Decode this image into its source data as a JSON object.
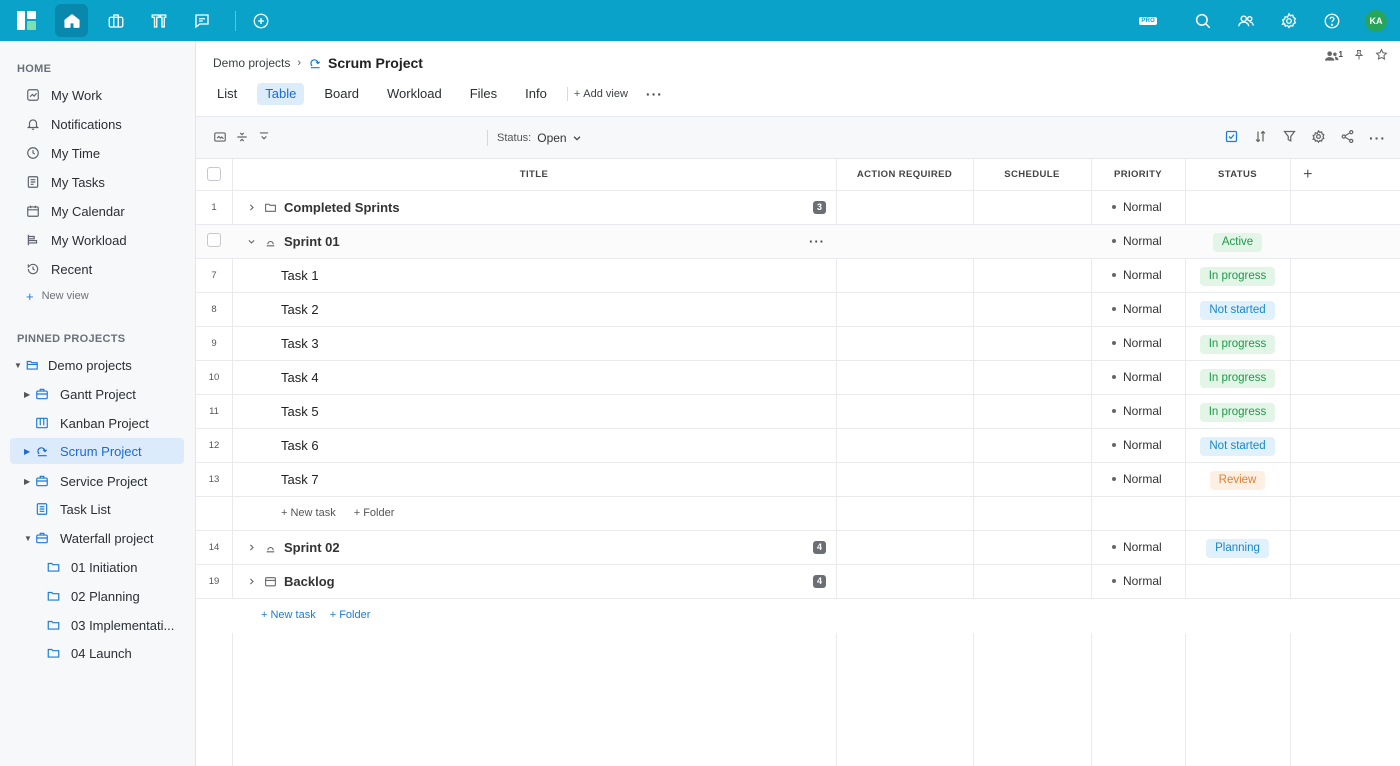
{
  "topbar": {
    "pro_badge": "PRO",
    "avatar_initials": "KA",
    "accent_color": "#0aa2c9"
  },
  "sidebar": {
    "home_section": "HOME",
    "home_items": [
      {
        "label": "My Work",
        "icon": "my-work-icon"
      },
      {
        "label": "Notifications",
        "icon": "bell-icon"
      },
      {
        "label": "My Time",
        "icon": "clock-icon"
      },
      {
        "label": "My Tasks",
        "icon": "tasks-icon"
      },
      {
        "label": "My Calendar",
        "icon": "calendar-icon"
      },
      {
        "label": "My Workload",
        "icon": "workload-icon"
      },
      {
        "label": "Recent",
        "icon": "history-icon"
      }
    ],
    "new_view": "New view",
    "pinned_section": "PINNED PROJECTS",
    "pinned_items": [
      {
        "label": "Demo projects"
      },
      {
        "label": "Gantt Project"
      },
      {
        "label": "Kanban Project"
      },
      {
        "label": "Scrum Project"
      },
      {
        "label": "Service Project"
      },
      {
        "label": "Task List"
      },
      {
        "label": "Waterfall project"
      },
      {
        "label": "01 Initiation"
      },
      {
        "label": "02 Planning"
      },
      {
        "label": "03 Implementati..."
      },
      {
        "label": "04 Launch"
      }
    ]
  },
  "header": {
    "breadcrumb_parent": "Demo projects",
    "project_title": "Scrum Project",
    "members_count": "1"
  },
  "tabs": [
    "List",
    "Table",
    "Board",
    "Workload",
    "Files",
    "Info"
  ],
  "add_view": "Add view",
  "toolbar": {
    "status_label": "Status:",
    "status_value": "Open"
  },
  "table": {
    "columns": [
      "TITLE",
      "ACTION REQUIRED",
      "SCHEDULE",
      "PRIORITY",
      "STATUS"
    ],
    "rows": [
      {
        "num": "1",
        "title": "Completed Sprints",
        "count": "3",
        "priority": "Normal",
        "status": ""
      },
      {
        "num": "",
        "title": "Sprint 01",
        "count": "",
        "priority": "Normal",
        "status": "Active"
      },
      {
        "num": "7",
        "title": "Task 1",
        "priority": "Normal",
        "status": "In progress"
      },
      {
        "num": "8",
        "title": "Task 2",
        "priority": "Normal",
        "status": "Not started"
      },
      {
        "num": "9",
        "title": "Task 3",
        "priority": "Normal",
        "status": "In progress"
      },
      {
        "num": "10",
        "title": "Task 4",
        "priority": "Normal",
        "status": "In progress"
      },
      {
        "num": "11",
        "title": "Task 5",
        "priority": "Normal",
        "status": "In progress"
      },
      {
        "num": "12",
        "title": "Task 6",
        "priority": "Normal",
        "status": "Not started"
      },
      {
        "num": "13",
        "title": "Task 7",
        "priority": "Normal",
        "status": "Review"
      },
      {
        "num": "14",
        "title": "Sprint 02",
        "count": "4",
        "priority": "Normal",
        "status": "Planning"
      },
      {
        "num": "19",
        "title": "Backlog",
        "count": "4",
        "priority": "Normal",
        "status": ""
      }
    ],
    "new_task": "+ New task",
    "new_folder": "+ Folder"
  },
  "status_colors": {
    "green": "#1e9a49",
    "blue": "#1a86c8",
    "orange": "#e0803a"
  }
}
